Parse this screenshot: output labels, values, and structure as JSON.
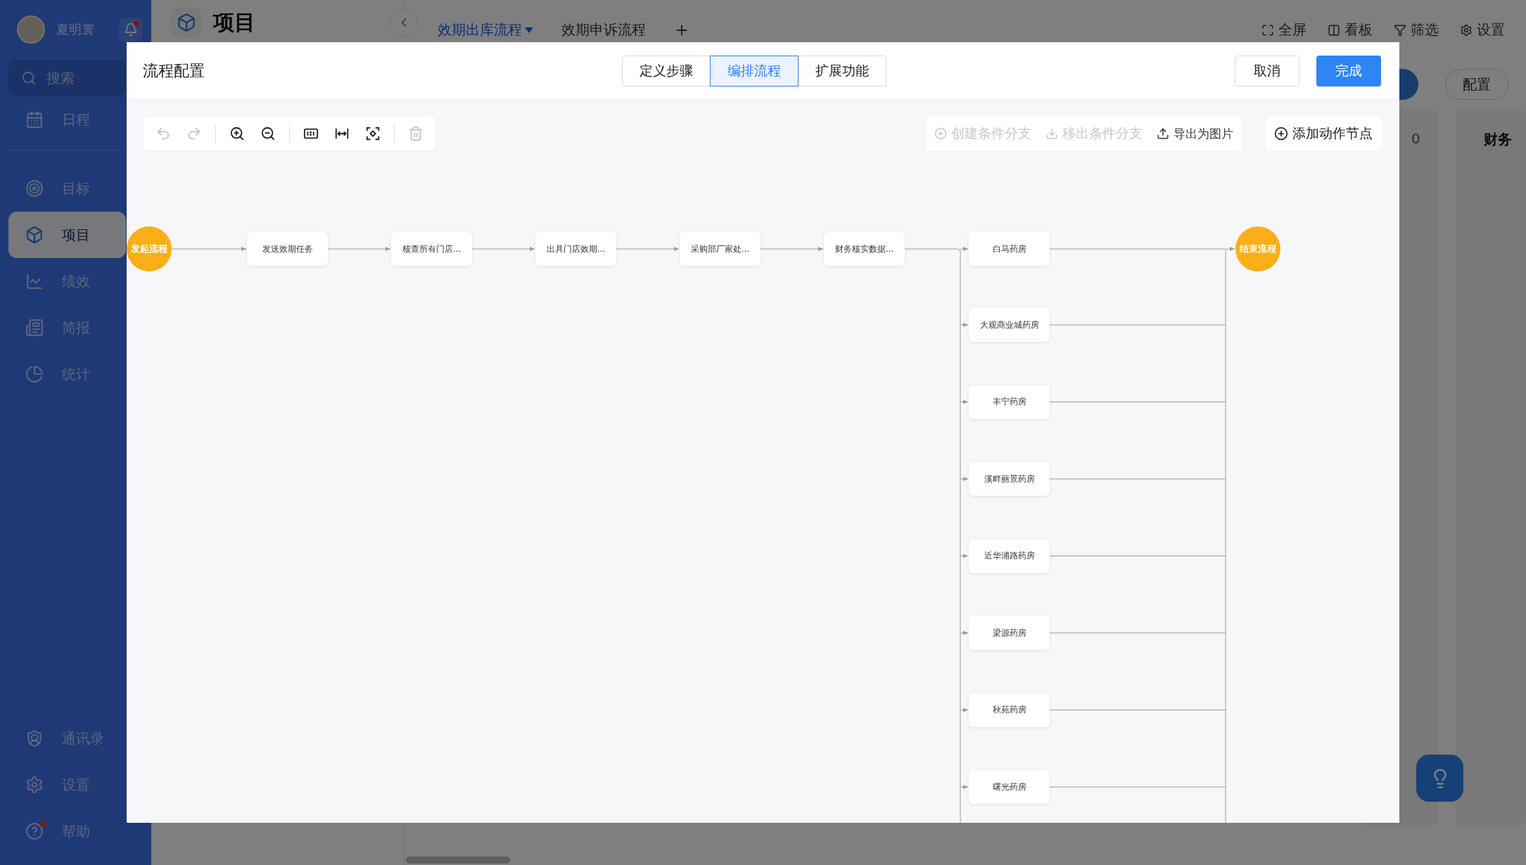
{
  "sidebar": {
    "user": {
      "name": "夏明寰",
      "unread": true
    },
    "search": {
      "placeholder": "搜索"
    },
    "top_items": [
      {
        "label": "日程",
        "selected": false
      }
    ],
    "items": [
      {
        "label": "目标",
        "selected": false
      },
      {
        "label": "项目",
        "selected": true
      },
      {
        "label": "绩效",
        "selected": false
      },
      {
        "label": "简报",
        "selected": false
      },
      {
        "label": "统计",
        "selected": false
      }
    ],
    "bottom_items": [
      {
        "label": "通讯录",
        "selected": false,
        "badge": false
      },
      {
        "label": "设置",
        "selected": false,
        "badge": false
      },
      {
        "label": "帮助",
        "selected": false,
        "badge": true
      }
    ]
  },
  "page": {
    "title": "项目",
    "tabs": [
      {
        "label": "效期出库流程",
        "selected": true
      },
      {
        "label": "效期申诉流程",
        "selected": false
      }
    ],
    "actions": [
      "全屏",
      "看板",
      "筛选",
      "设置"
    ],
    "config_button": "配置",
    "cell": "0",
    "column_2": "财务"
  },
  "dialog": {
    "title": "流程配置",
    "steps": [
      {
        "label": "定义步骤",
        "selected": false
      },
      {
        "label": "编排流程",
        "selected": true
      },
      {
        "label": "扩展功能",
        "selected": false
      }
    ],
    "cancel": "取消",
    "confirm": "完成",
    "tools": [
      {
        "kind": "undo",
        "disabled": true
      },
      {
        "kind": "redo",
        "disabled": true
      },
      {
        "kind": "zoom-in",
        "disabled": false
      },
      {
        "kind": "zoom-out",
        "disabled": false
      },
      {
        "kind": "actual-size",
        "disabled": false
      },
      {
        "kind": "fit-width",
        "disabled": false
      },
      {
        "kind": "center",
        "disabled": false
      },
      {
        "kind": "delete",
        "disabled": true
      }
    ],
    "actions": [
      {
        "kind": "create",
        "label": "创建条件分支",
        "disabled": true
      },
      {
        "kind": "remove",
        "label": "移出条件分支",
        "disabled": true
      },
      {
        "kind": "export",
        "label": "导出为图片",
        "disabled": false
      }
    ],
    "add_node": "添加动作节点",
    "flow": {
      "start": "发起流程",
      "steps": [
        "发送效期任务",
        "核查所有门店...",
        "出具门店效期...",
        "采购部厂家处...",
        "财务核实数据..."
      ],
      "branches": [
        "白马药房",
        "大观商业城药房",
        "丰宁药房",
        "溪畔丽景药房",
        "近华浦路药房",
        "梁源药房",
        "秋苑药房",
        "曙光药房"
      ],
      "end": "结束流程"
    }
  }
}
